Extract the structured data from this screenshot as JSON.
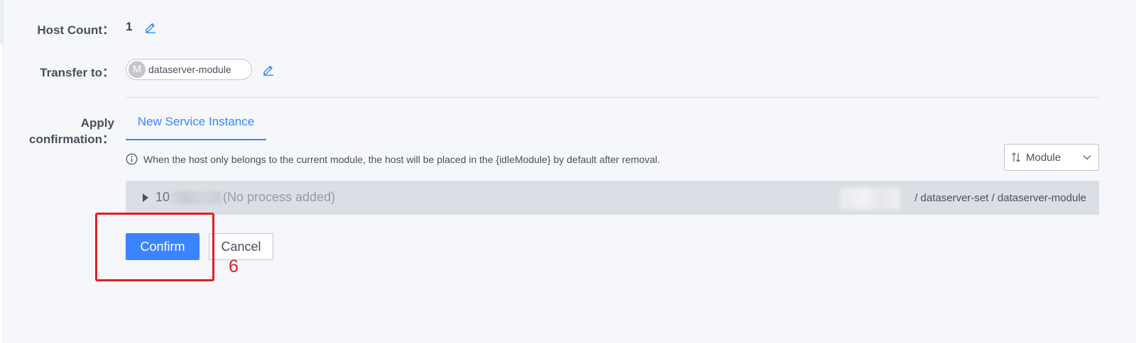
{
  "form": {
    "host_count": {
      "label": "Host Count：",
      "value": "1",
      "edit_icon": "pencil-edit-icon"
    },
    "transfer_to": {
      "label": "Transfer to：",
      "module_avatar": "M",
      "module_name": "dataserver-module",
      "edit_icon": "pencil-edit-icon"
    },
    "apply_confirmation": {
      "label_line1": "Apply",
      "label_line2": "confirmation："
    }
  },
  "tabs": [
    {
      "label": "New Service Instance",
      "active": true
    }
  ],
  "info": {
    "icon": "info-circle-icon",
    "text": "When the host only belongs to the current module, the host will be placed in the {idleModule} by default after removal."
  },
  "sort_select": {
    "icon": "sort-icon",
    "value": "Module",
    "chevron": "chevron-down-icon"
  },
  "host_row": {
    "ip_prefix": "10",
    "status": "(No process added)",
    "path": "/ dataserver-set / dataserver-module"
  },
  "buttons": {
    "confirm": "Confirm",
    "cancel": "Cancel"
  },
  "annotation": {
    "number": "6"
  },
  "colors": {
    "primary": "#3a84ff",
    "background": "#f5f7fb",
    "annotation_red": "#e02020",
    "row_background": "#dcdee5"
  }
}
